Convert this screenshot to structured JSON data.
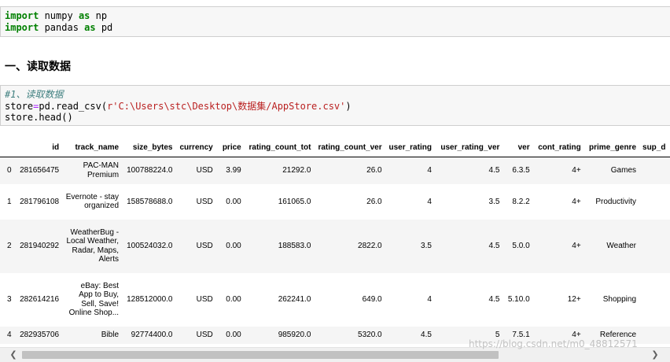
{
  "cell1": {
    "line1": {
      "kw1": "import",
      "mod": " numpy ",
      "kw2": "as",
      "alias": " np"
    },
    "line2": {
      "kw1": "import",
      "mod": " pandas ",
      "kw2": "as",
      "alias": " pd"
    }
  },
  "heading": "一、读取数据",
  "cell2": {
    "comment": "#1、读取数据",
    "line2": {
      "var": "store",
      "eq": "=",
      "call": "pd.read_csv(",
      "prefix": "r",
      "str": "'C:\\Users\\stc\\Desktop\\数据集/AppStore.csv'",
      "close": ")"
    },
    "line3": "store.head()"
  },
  "table": {
    "columns": [
      "",
      "id",
      "track_name",
      "size_bytes",
      "currency",
      "price",
      "rating_count_tot",
      "rating_count_ver",
      "user_rating",
      "user_rating_ver",
      "ver",
      "cont_rating",
      "prime_genre",
      "sup_d"
    ],
    "rows": [
      {
        "index": "0",
        "cells": [
          "281656475",
          "PAC-MAN Premium",
          "100788224.0",
          "USD",
          "3.99",
          "21292.0",
          "26.0",
          "4",
          "4.5",
          "6.3.5",
          "4+",
          "Games",
          ""
        ]
      },
      {
        "index": "1",
        "cells": [
          "281796108",
          "Evernote - stay organized",
          "158578688.0",
          "USD",
          "0.00",
          "161065.0",
          "26.0",
          "4",
          "3.5",
          "8.2.2",
          "4+",
          "Productivity",
          ""
        ]
      },
      {
        "index": "2",
        "cells": [
          "281940292",
          "WeatherBug - Local Weather, Radar, Maps, Alerts",
          "100524032.0",
          "USD",
          "0.00",
          "188583.0",
          "2822.0",
          "3.5",
          "4.5",
          "5.0.0",
          "4+",
          "Weather",
          ""
        ]
      },
      {
        "index": "3",
        "cells": [
          "282614216",
          "eBay: Best App to Buy, Sell, Save! Online Shop...",
          "128512000.0",
          "USD",
          "0.00",
          "262241.0",
          "649.0",
          "4",
          "4.5",
          "5.10.0",
          "12+",
          "Shopping",
          ""
        ]
      },
      {
        "index": "4",
        "cells": [
          "282935706",
          "Bible",
          "92774400.0",
          "USD",
          "0.00",
          "985920.0",
          "5320.0",
          "4.5",
          "5",
          "7.5.1",
          "4+",
          "Reference",
          ""
        ]
      }
    ]
  },
  "scrollbar": {
    "left_icon": "arrow-left-icon",
    "right_icon": "arrow-right-icon",
    "left_glyph": "❮",
    "right_glyph": "❯"
  },
  "watermark": "https://blog.csdn.net/m0_48812571"
}
